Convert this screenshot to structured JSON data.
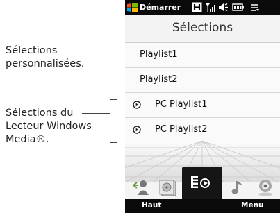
{
  "annotations": {
    "custom": [
      "Sélections",
      "personnalisées."
    ],
    "wmp": [
      "Sélections du",
      "Lecteur Windows",
      "Media®."
    ]
  },
  "status_bar": {
    "start_label": "Démarrer",
    "icons": [
      "windows-logo-icon",
      "h-connection-icon",
      "signal-icon",
      "speaker-icon",
      "battery-icon",
      "menu-arrows-icon"
    ]
  },
  "screen": {
    "title": "Sélections"
  },
  "playlists": [
    {
      "label": "Playlist1",
      "type": "custom"
    },
    {
      "label": "Playlist2",
      "type": "custom"
    },
    {
      "label": "PC Playlist1",
      "type": "wmp"
    },
    {
      "label": "PC Playlist2",
      "type": "wmp"
    }
  ],
  "tabs": [
    {
      "icon": "artists-icon",
      "active": false
    },
    {
      "icon": "album-icon",
      "active": false
    },
    {
      "icon": "playlists-icon",
      "active": true
    },
    {
      "icon": "music-note-icon",
      "active": false
    },
    {
      "icon": "podcast-icon",
      "active": false
    }
  ],
  "softkeys": {
    "left": "Haut",
    "right": "Menu"
  },
  "colors": {
    "bar_background": "#0a0a0a",
    "active_tab": "#151515",
    "list_background": "#fafafa"
  }
}
